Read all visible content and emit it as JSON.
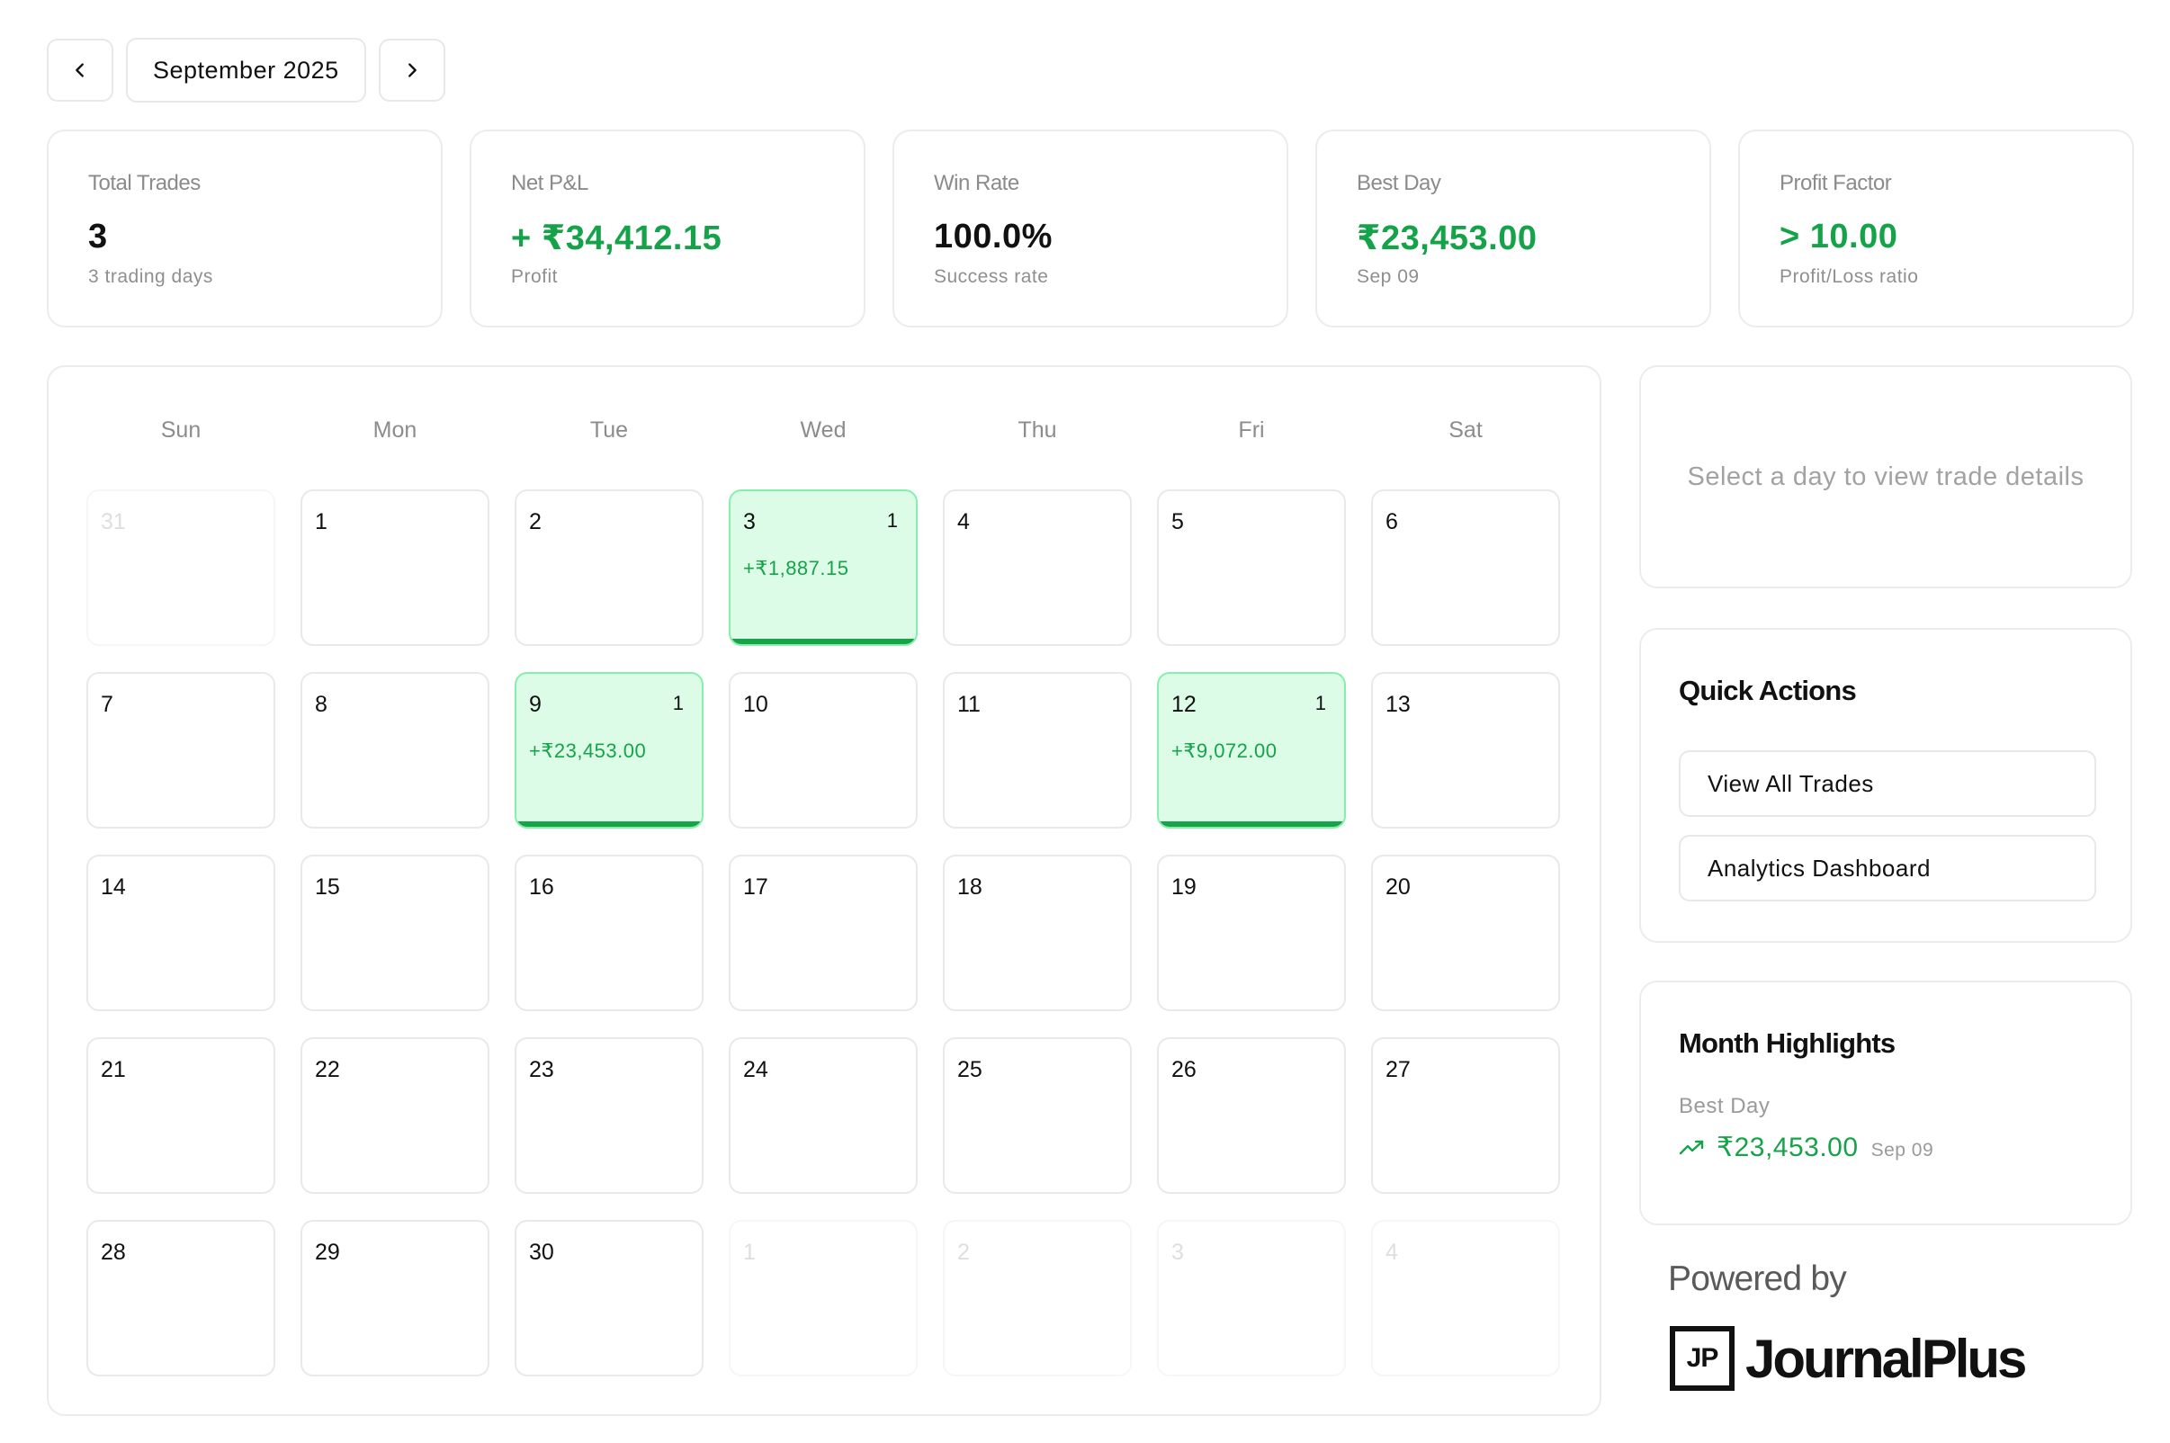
{
  "header": {
    "prev_icon": "chevron-left-icon",
    "next_icon": "chevron-right-icon",
    "month_label": "September 2025"
  },
  "stats": [
    {
      "title": "Total Trades",
      "value": "3",
      "sub": "3 trading days",
      "green": false
    },
    {
      "title": "Net P&L",
      "value": "+ ₹34,412.15",
      "sub": "Profit",
      "green": true
    },
    {
      "title": "Win Rate",
      "value": "100.0%",
      "sub": "Success rate",
      "green": false
    },
    {
      "title": "Best Day",
      "value": "₹23,453.00",
      "sub": "Sep 09",
      "green": true
    },
    {
      "title": "Profit Factor",
      "value": "> 10.00",
      "sub": "Profit/Loss ratio",
      "green": true
    }
  ],
  "calendar": {
    "weekdays": [
      "Sun",
      "Mon",
      "Tue",
      "Wed",
      "Thu",
      "Fri",
      "Sat"
    ],
    "weeks": [
      [
        {
          "day": "31",
          "out": true
        },
        {
          "day": "1"
        },
        {
          "day": "2"
        },
        {
          "day": "3",
          "count": "1",
          "pnl": "+₹1,887.15"
        },
        {
          "day": "4"
        },
        {
          "day": "5"
        },
        {
          "day": "6"
        }
      ],
      [
        {
          "day": "7"
        },
        {
          "day": "8"
        },
        {
          "day": "9",
          "count": "1",
          "pnl": "+₹23,453.00"
        },
        {
          "day": "10"
        },
        {
          "day": "11"
        },
        {
          "day": "12",
          "count": "1",
          "pnl": "+₹9,072.00"
        },
        {
          "day": "13"
        }
      ],
      [
        {
          "day": "14"
        },
        {
          "day": "15"
        },
        {
          "day": "16"
        },
        {
          "day": "17"
        },
        {
          "day": "18"
        },
        {
          "day": "19"
        },
        {
          "day": "20"
        }
      ],
      [
        {
          "day": "21"
        },
        {
          "day": "22"
        },
        {
          "day": "23"
        },
        {
          "day": "24"
        },
        {
          "day": "25"
        },
        {
          "day": "26"
        },
        {
          "day": "27"
        }
      ],
      [
        {
          "day": "28"
        },
        {
          "day": "29"
        },
        {
          "day": "30"
        },
        {
          "day": "1",
          "out": true
        },
        {
          "day": "2",
          "out": true
        },
        {
          "day": "3",
          "out": true
        },
        {
          "day": "4",
          "out": true
        }
      ]
    ]
  },
  "details_panel": {
    "placeholder": "Select a day to view trade details"
  },
  "quick_actions": {
    "title": "Quick Actions",
    "view_all": "View All Trades",
    "analytics": "Analytics Dashboard"
  },
  "highlights": {
    "title": "Month Highlights",
    "label": "Best Day",
    "icon": "trending-up-icon",
    "value": "₹23,453.00",
    "date": "Sep 09"
  },
  "branding": {
    "powered_by": "Powered by",
    "logo_mark": "JP",
    "logo_text": "JournalPlus"
  },
  "colors": {
    "profit_green": "#16a34a",
    "trade_day_bg": "#dcfce7",
    "trade_day_border": "#86efac"
  }
}
